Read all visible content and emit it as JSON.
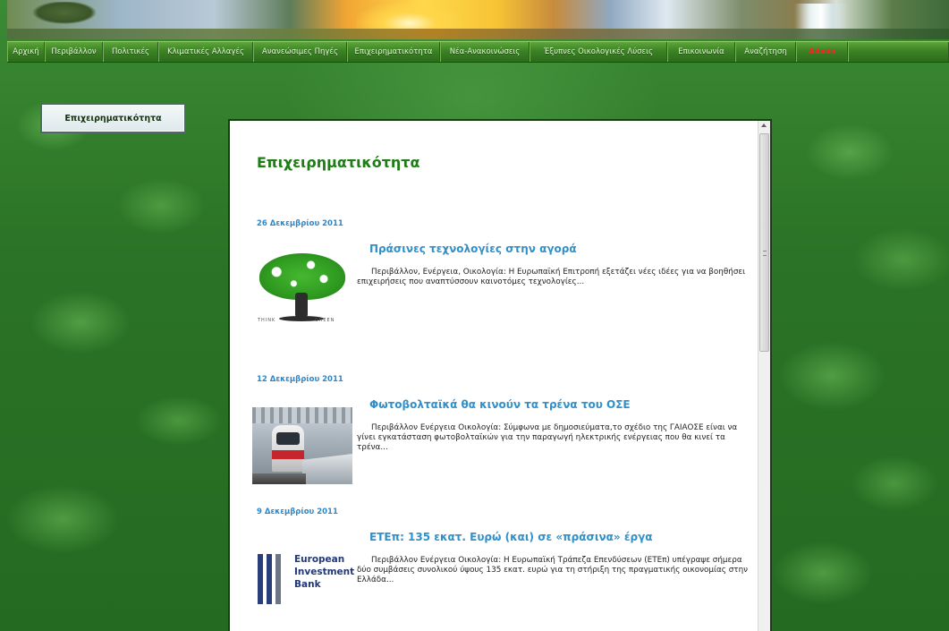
{
  "nav": {
    "items": [
      "Αρχική",
      "Περιβάλλον",
      "Πολιτικές",
      "Κλιματικές Αλλαγές",
      "Ανανεώσιμες Πηγές",
      "Επιχειρηματικότητα",
      "Νέα-Ανακοινώσεις",
      "Έξυπνες Οικολογικές Λύσεις",
      "Επικοινωνία",
      "Αναζήτηση",
      "Admin"
    ]
  },
  "sidebar": {
    "button_label": "Επιχειρηματικότητα"
  },
  "main": {
    "title": "Επιχειρηματικότητα",
    "articles": [
      {
        "date": "26 Δεκεμβρίου 2011",
        "title": "Πράσινες τεχνολογίες στην αγορά",
        "excerpt": "Περιβάλλον, Ενέργεια, Οικολογία: Η Ευρωπαϊκή Επιτροπή εξετάζει νέες ιδέες για να βοηθήσει επιχειρήσεις που αναπτύσσουν καινοτόμες τεχνολογίες...",
        "image_words": [
          "THINK",
          "GREEN"
        ]
      },
      {
        "date": "12 Δεκεμβρίου 2011",
        "title": "Φωτοβολταϊκά θα κινούν τα τρένα του ΟΣΕ",
        "excerpt": "Περιβάλλον Ενέργεια Οικολογία: Σύμφωνα με δημοσιεύματα,το σχέδιο της ΓΑΙΑΟΣΕ είναι να γίνει εγκατάσταση φωτοβολταϊκών για την παραγωγή ηλεκτρικής ενέργειας που θα κινεί τα τρένα..."
      },
      {
        "date": "9 Δεκεμβρίου 2011",
        "title": "ΕΤΕπ: 135 εκατ. Ευρώ (και) σε «πράσινα» έργα",
        "excerpt": "Περιβάλλον Ενέργεια Οικολογία: Η Ευρωπαϊκή Τράπεζα Επενδύσεων (ΕΤΕπ) υπέγραψε σήμερα δύο συμβάσεις συνολικού ύψους 135 εκατ. ευρώ για τη στήριξη της πραγματικής οικονομίας στην Ελλάδα...",
        "logo_lines": [
          "European",
          "Investment",
          "Bank"
        ]
      }
    ]
  },
  "colors": {
    "nav_admin": "#ff2424",
    "title_green": "#1e7d15",
    "link_blue": "#3190c9"
  }
}
